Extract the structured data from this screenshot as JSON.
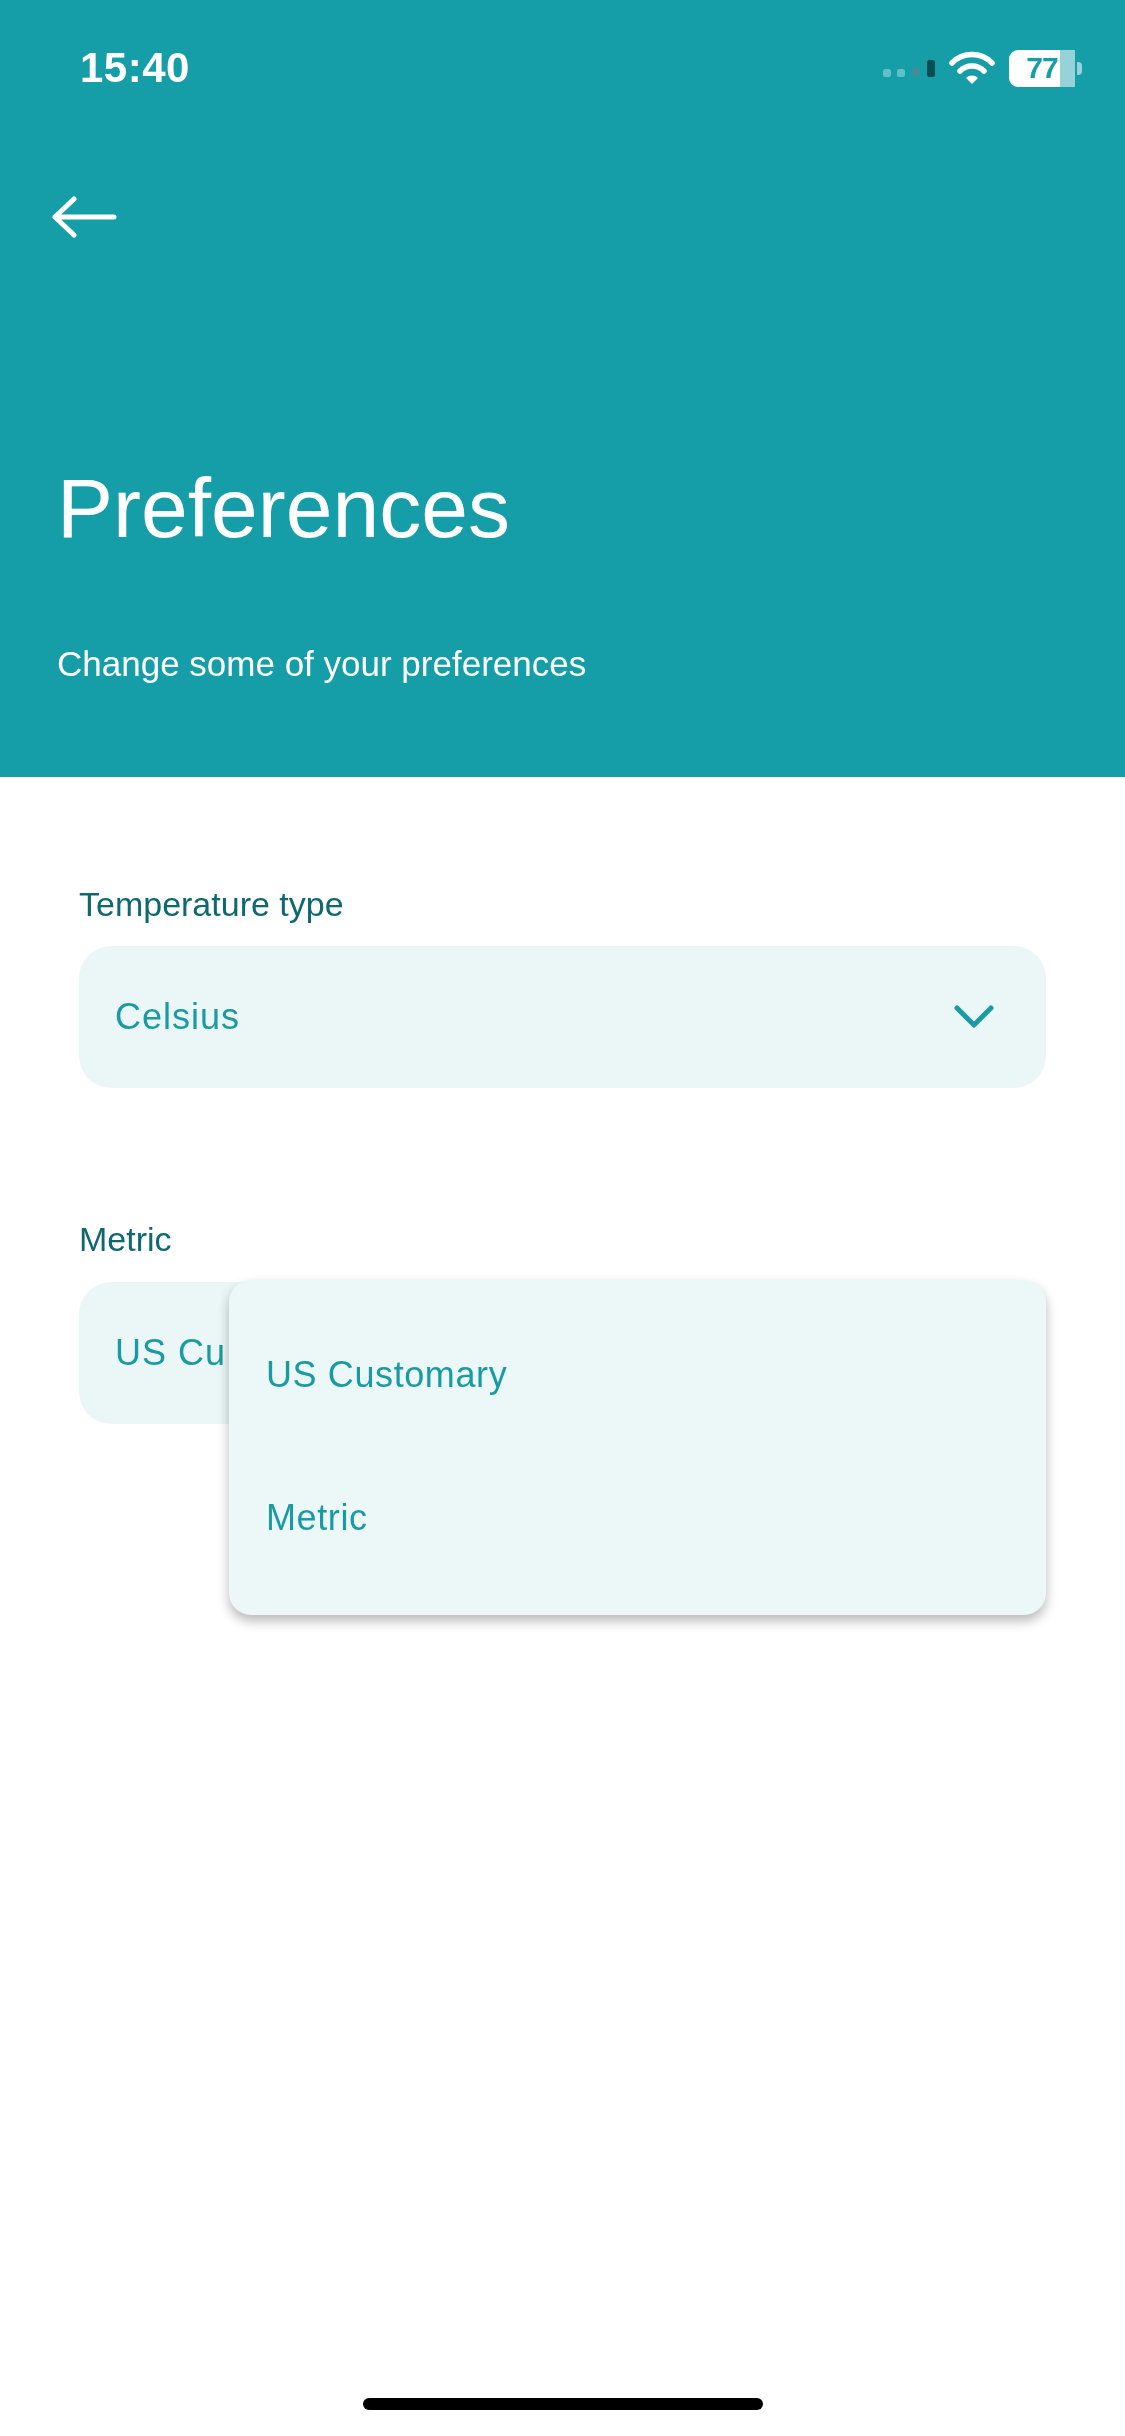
{
  "status_bar": {
    "time": "15:40",
    "battery": "77"
  },
  "header": {
    "title": "Preferences",
    "subtitle": "Change some of your preferences"
  },
  "fields": [
    {
      "label": "Temperature type",
      "value": "Celsius"
    },
    {
      "label": "Metric",
      "value": "US Cu",
      "options": [
        {
          "label": "US Customary",
          "selected": false
        },
        {
          "label": "Metric",
          "selected": false
        }
      ]
    }
  ]
}
